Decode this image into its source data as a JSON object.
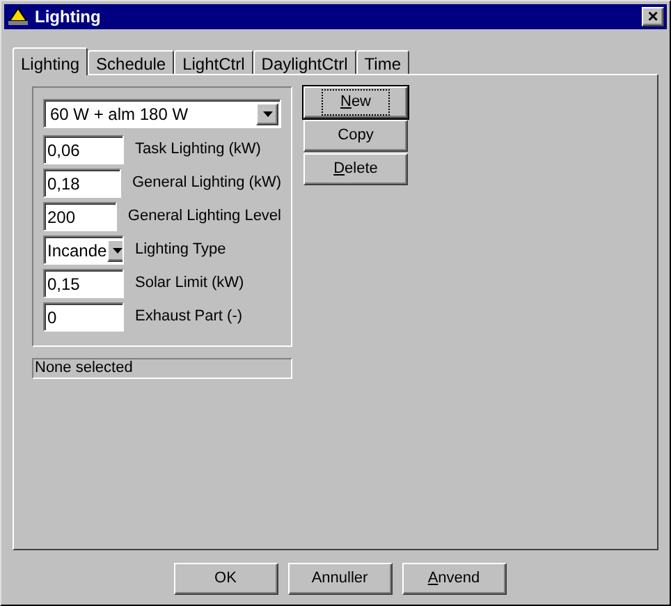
{
  "window": {
    "title": "Lighting",
    "close": "×"
  },
  "tabs": [
    {
      "label": "Lighting",
      "selected": true
    },
    {
      "label": "Schedule",
      "selected": false
    },
    {
      "label": "LightCtrl",
      "selected": false
    },
    {
      "label": "DaylightCtrl",
      "selected": false
    },
    {
      "label": "Time",
      "selected": false
    }
  ],
  "preset": {
    "value": "60 W + alm 180 W"
  },
  "fields": [
    {
      "kind": "text",
      "value": "0,06",
      "label": "Task Lighting (kW)"
    },
    {
      "kind": "text",
      "value": "0,18",
      "label": "General Lighting (kW)"
    },
    {
      "kind": "text",
      "value": "200",
      "label": "General Lighting Level"
    },
    {
      "kind": "dropdown",
      "value": "Incande",
      "label": "Lighting Type"
    },
    {
      "kind": "text",
      "value": "0,15",
      "label": "Solar Limit (kW)"
    },
    {
      "kind": "text",
      "value": "0",
      "label": "Exhaust Part (-)"
    }
  ],
  "side_buttons": [
    {
      "label": "New",
      "access_key": true,
      "focused": true
    },
    {
      "label": "Copy",
      "access_key": false,
      "focused": false
    },
    {
      "label": "Delete",
      "access_key": true,
      "focused": false
    }
  ],
  "status": "None selected",
  "footer_buttons": [
    {
      "label": "OK",
      "access_key": false
    },
    {
      "label": "Annuller",
      "access_key": false
    },
    {
      "label": "Anvend",
      "access_key": true
    }
  ]
}
